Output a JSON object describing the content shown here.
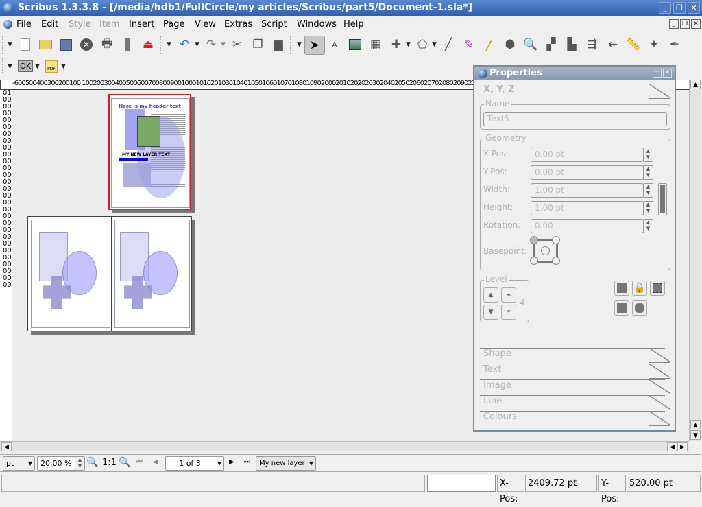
{
  "window": {
    "title": "Scribus 1.3.3.8 - [/media/hdb1/FullCircle/my articles/Scribus/part5/Document-1.sla*]",
    "controls": [
      "minimize",
      "maximize",
      "close"
    ]
  },
  "menu": [
    {
      "label": "File",
      "enabled": true
    },
    {
      "label": "Edit",
      "enabled": true
    },
    {
      "label": "Style",
      "enabled": false
    },
    {
      "label": "Item",
      "enabled": false
    },
    {
      "label": "Insert",
      "enabled": true
    },
    {
      "label": "Page",
      "enabled": true
    },
    {
      "label": "View",
      "enabled": true
    },
    {
      "label": "Extras",
      "enabled": true
    },
    {
      "label": "Script",
      "enabled": true
    },
    {
      "label": "Windows",
      "enabled": true
    },
    {
      "label": "Help",
      "enabled": true
    }
  ],
  "toolbar2": {
    "ok_label": "OK",
    "pdf_label": "PDF"
  },
  "ruler": {
    "horizontal": "-600500400300200100  1002003004005006007008009001000101020103010401050106010701080109020002010202020302040205020602070208020902100 104",
    "vertical": "0100000000000000000000000000000000000000000000000000000000"
  },
  "document": {
    "header_text": "Here is my header text",
    "layer_text": "MY NEW LAYER TEXT"
  },
  "properties": {
    "title": "Properties",
    "section_xyz": "X, Y, Z",
    "name_group": "Name",
    "name_value": "Text5",
    "geometry_group": "Geometry",
    "xpos_label": "X-Pos:",
    "xpos_value": "0.00 pt",
    "ypos_label": "Y-Pos:",
    "ypos_value": "0.00 pt",
    "width_label": "Width:",
    "width_value": "1.00 pt",
    "height_label": "Height:",
    "height_value": "1.00 pt",
    "rotation_label": "Rotation:",
    "rotation_value": "0.00",
    "basepoint_label": "Basepoint:",
    "level_group": "Level",
    "level_value": "4",
    "sections": [
      "Shape",
      "Text",
      "Image",
      "Line",
      "Colours"
    ]
  },
  "bottombar": {
    "unit": "pt",
    "zoom": "20.00 %",
    "zoom_reset": "1:1",
    "page": "1 of 3",
    "layer": "My new layer"
  },
  "status": {
    "message": "",
    "xpos_label": "X-Pos:",
    "xpos_value": "2409.72 pt",
    "ypos_label": "Y-Pos:",
    "ypos_value": "520.00 pt"
  }
}
